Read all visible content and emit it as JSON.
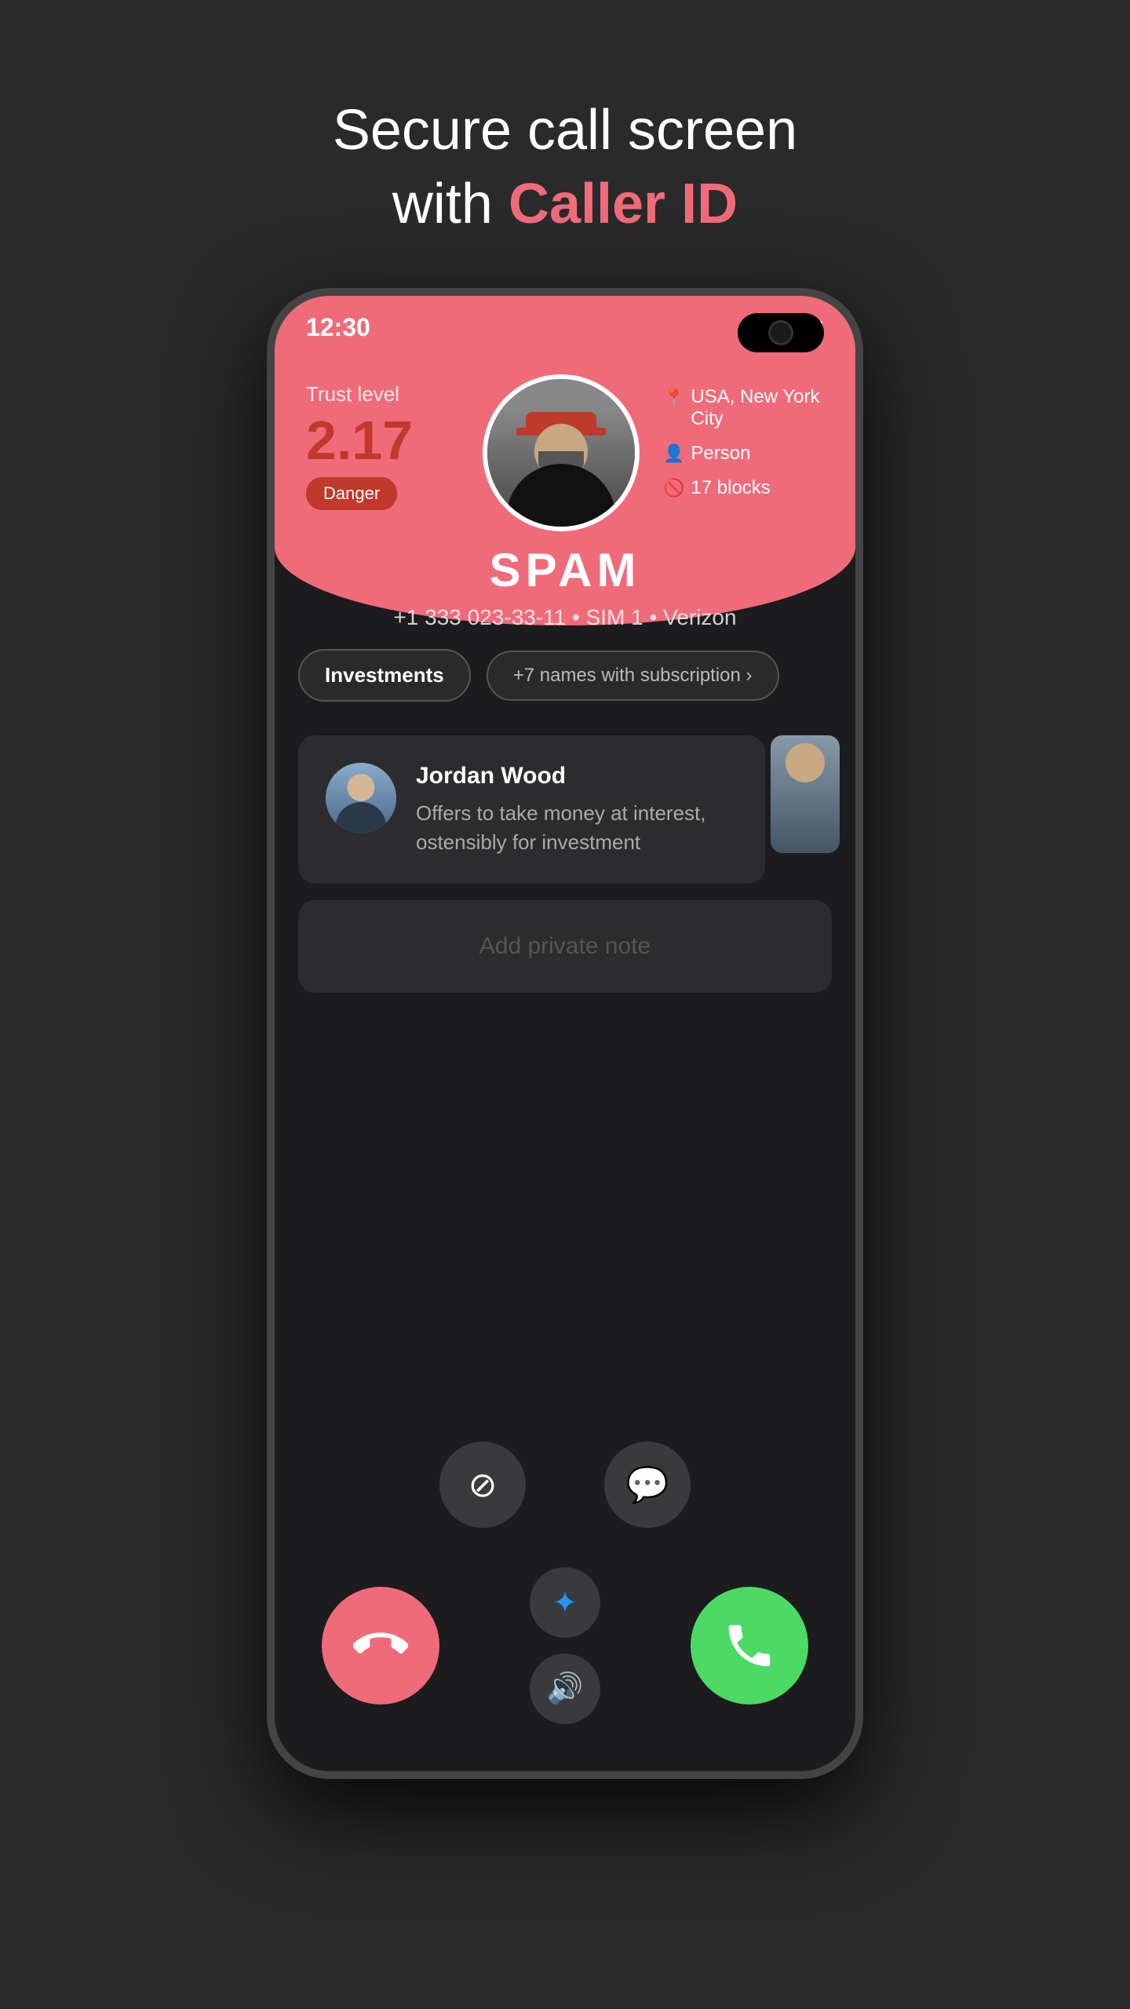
{
  "page": {
    "title_line1": "Secure call screen",
    "title_line2_prefix": "with ",
    "title_line2_highlight": "Caller ID"
  },
  "status_bar": {
    "time": "12:30"
  },
  "caller": {
    "trust_label": "Trust level",
    "trust_number": "2.17",
    "danger_label": "Danger",
    "location": "USA, New York City",
    "type": "Person",
    "blocks": "17 blocks",
    "name": "SPAM",
    "number": "+1 333 023-33-11",
    "sim": "SIM 1",
    "carrier": "Verizon"
  },
  "tags": {
    "category": "Investments",
    "subscription": "+7 names with subscription ›"
  },
  "info_card": {
    "reporter_name": "Jordan Wood",
    "reporter_text": "Offers to take money at interest, ostensibly for investment"
  },
  "note": {
    "placeholder": "Add private note"
  },
  "buttons": {
    "decline_label": "✆",
    "accept_label": "✆",
    "block_icon": "🚫",
    "message_icon": "💬",
    "bluetooth_icon": "✦",
    "speaker_icon": "🔊"
  }
}
